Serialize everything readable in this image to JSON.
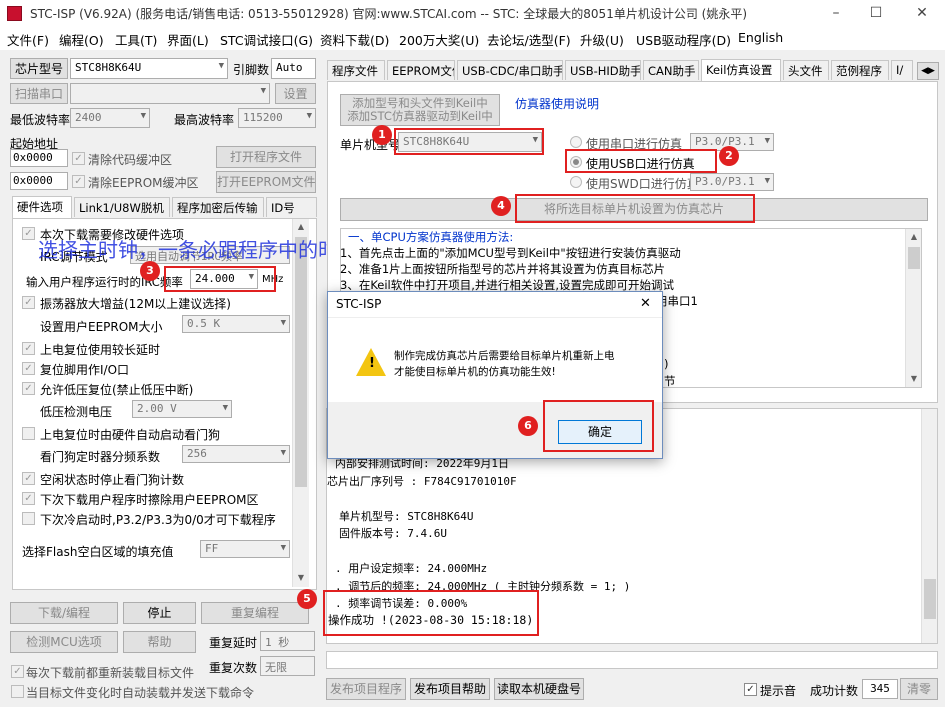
{
  "window": {
    "title": "STC-ISP (V6.92A) (服务电话/销售电话: 0513-55012928) 官网:www.STCAI.com  -- STC: 全球最大的8051单片机设计公司 (姚永平)",
    "minimize": "–",
    "maximize": "☐",
    "close": "✕"
  },
  "menu": [
    "文件(F)",
    "编程(O)",
    "工具(T)",
    "界面(L)",
    "STC调试接口(G)",
    "资料下载(D)",
    "200万大奖(U)",
    "去论坛/选型(F)",
    "升级(U)",
    "USB驱动程序(D)",
    "English"
  ],
  "left": {
    "chip_label": "芯片型号",
    "chip_value": "STC8H8K64U",
    "pin_label": "引脚数",
    "pin_value": "Auto",
    "scan_port_btn": "扫描串口",
    "port_value": "",
    "settings_btn": "设置",
    "min_baud_label": "最低波特率",
    "min_baud_value": "2400",
    "max_baud_label": "最高波特率",
    "max_baud_value": "115200",
    "start_addr_label": "起始地址",
    "addr1": "0x0000",
    "clear_code": "清除代码缓冲区",
    "open_prog_btn": "打开程序文件",
    "addr2": "0x0000",
    "clear_eeprom": "清除EEPROM缓冲区",
    "open_eeprom_btn": "打开EEPROM文件",
    "tabs": [
      "硬件选项",
      "Link1/U8W脱机",
      "程序加密后传输",
      "ID号"
    ],
    "overlay_text": "选择主时钟，一条必跟程序中的时钟统一一致",
    "options": {
      "opt_modify_hw": "本次下载需要修改硬件选项",
      "irc_mode_label": "IRC调节模式",
      "irc_mode_value": "选用自动调节IRC频率",
      "freq_label": "输入用户程序运行时的IRC频率",
      "freq_value": "24.000",
      "freq_unit": "MHz",
      "osc_gain": "振荡器放大增益(12M以上建议选择)",
      "eeprom_size_label": "设置用户EEPROM大小",
      "eeprom_size_value": "0.5 K",
      "por_delay": "上电复位使用较长延时",
      "reset_io": "复位脚用作I/O口",
      "lvr": "允许低压复位(禁止低压中断)",
      "lvd_label": "低压检测电压",
      "lvd_value": "2.00 V",
      "wdt_auto": "上电复位时由硬件自动启动看门狗",
      "wdt_div_label": "看门狗定时器分频系数",
      "wdt_div_value": "256",
      "idle_wdt": "空闲状态时停止看门狗计数",
      "erase_eeprom": "下次下载用户程序时擦除用户EEPROM区",
      "p32_p33": "下次冷启动时,P3.2/P3.3为0/0才可下载程序",
      "fill_label": "选择Flash空白区域的填充值",
      "fill_value": "FF"
    },
    "download_btn": "下载/编程",
    "stop_btn": "停止",
    "reprog_btn": "重复编程",
    "detect_btn": "检测MCU选项",
    "help_btn": "帮助",
    "retry_delay_label": "重复延时",
    "retry_delay_value": "1 秒",
    "retry_count_label": "重复次数",
    "retry_count_value": "无限",
    "reload_every": "每次下载前都重新装载目标文件",
    "auto_send": "当目标文件变化时自动装载并发送下载命令"
  },
  "right": {
    "tabs": [
      "程序文件",
      "EEPROM文件",
      "USB-CDC/串口助手",
      "USB-HID助手",
      "CAN助手",
      "Keil仿真设置",
      "头文件",
      "范例程序",
      "I/"
    ],
    "add_keil_btn_line1": "添加型号和头文件到Keil中",
    "add_keil_btn_line2": "添加STC仿真器驱动到Keil中",
    "emu_help_link": "仿真器使用说明",
    "mcu_label": "单片机型号",
    "mcu_value": "STC8H8K64U",
    "radio_serial": "使用串口进行仿真",
    "radio_serial_port": "P3.0/P3.1",
    "radio_usb": "使用USB口进行仿真",
    "radio_swd": "使用SWD口进行仿真",
    "radio_swd_port": "P3.0/P3.1",
    "set_emu_btn": "将所选目标单片机设置为仿真芯片",
    "instructions": [
      "一、单CPU方案仿真器使用方法:",
      "1、首先点击上面的\"添加MCU型号到Keil中\"按钮进行安装仿真驱动",
      "2、准备1片上面按钮所指型号的芯片并将其设置为仿真目标芯片",
      "3、在Keil软件中打开项目,并进行相关设置,设置完成即可开始调试",
      "用串口1"
    ],
    "instr_tail_1": ")",
    "instr_tail_2": "节",
    "log_lines": [
      "内部安排测试时间: 2022年9月1日",
      "芯片出厂序列号 : F784C91701010F",
      "",
      "单片机型号: STC8H8K64U",
      "固件版本号: 7.4.6U",
      "",
      ". 用户设定频率: 24.000MHz",
      ". 调节后的频率: 24.000MHz ( 主时钟分频系数 = 1; )",
      ". 频率调节误差: 0.000%"
    ],
    "success": "操作成功 !(2023-08-30 15:18:18)",
    "publish_prog_btn": "发布项目程序",
    "publish_help_btn": "发布项目帮助",
    "read_disk_btn": "读取本机硬盘号",
    "beep_label": "提示音",
    "count_label": "成功计数",
    "count_value": "345",
    "clear_btn": "清零"
  },
  "dialog": {
    "title": "STC-ISP",
    "close": "✕",
    "message_line1": "制作完成仿真芯片后需要给目标单片机重新上电",
    "message_line2": "才能使目标单片机的仿真功能生效!",
    "ok_btn": "确定"
  },
  "markers": [
    "1",
    "2",
    "3",
    "4",
    "5",
    "6"
  ],
  "colors": {
    "accent_red": "#e02020",
    "link_blue": "#0033cc",
    "overlay_blue": "#2233dd"
  }
}
